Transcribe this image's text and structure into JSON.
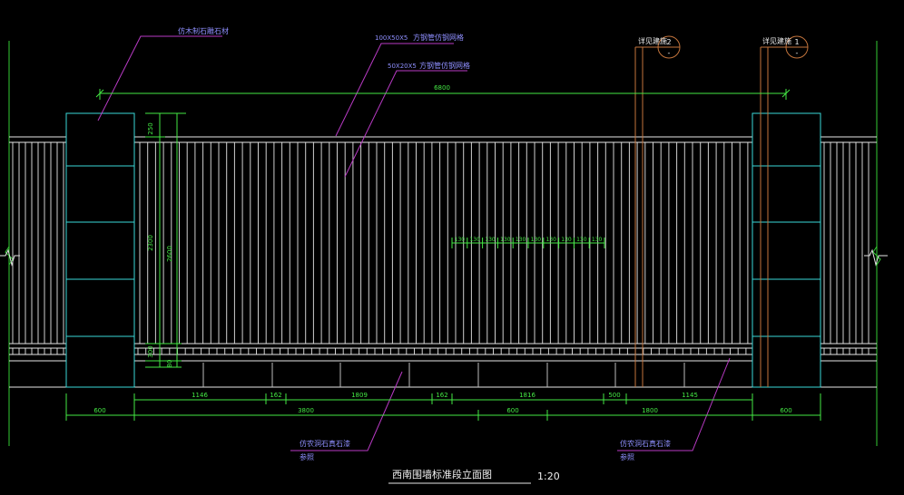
{
  "drawing": {
    "title": "西南围墙标准段立面图",
    "scale": "1:20",
    "colors": {
      "background": "#000000",
      "pillar": "#3ad7d7",
      "fence": "#e6e6e6",
      "dimension": "#44e844",
      "leader": "#b83ac4",
      "callout": "#c3743c",
      "callout_text": "#f0f0f0",
      "label": "#8f8fff",
      "frame": "#33cc33"
    },
    "top_labels": {
      "pillar_stone": "仿木制石雕石材",
      "rail_top": "100X50X5",
      "rail_top_desc": "方钢管仿钢网格",
      "bars": "50X20X5",
      "bars_desc": "方钢管仿钢网格"
    },
    "callouts": [
      {
        "text": "详见建施",
        "number": "2",
        "sub": "-"
      },
      {
        "text": "详见建施",
        "number": "1",
        "sub": "-"
      }
    ],
    "bottom_labels": [
      {
        "line1": "仿农洞石真石漆",
        "line2": "参照"
      },
      {
        "line1": "仿农洞石真石漆",
        "line2": "参照"
      }
    ],
    "dimensions": {
      "overall_width": "6800",
      "top_offset": "250",
      "fence_height_inner": "2300",
      "fence_height_total": "2600",
      "low_section": "300",
      "base": "80",
      "bar_spacing": [
        "130",
        "130",
        "130",
        "130",
        "130",
        "130",
        "130",
        "130",
        "130",
        "130"
      ],
      "row1": [
        "1146",
        "162",
        "1809",
        "162",
        "1816",
        "500",
        "1145"
      ],
      "row2": [
        "600",
        "3800",
        "600",
        "1800",
        "600"
      ]
    }
  }
}
